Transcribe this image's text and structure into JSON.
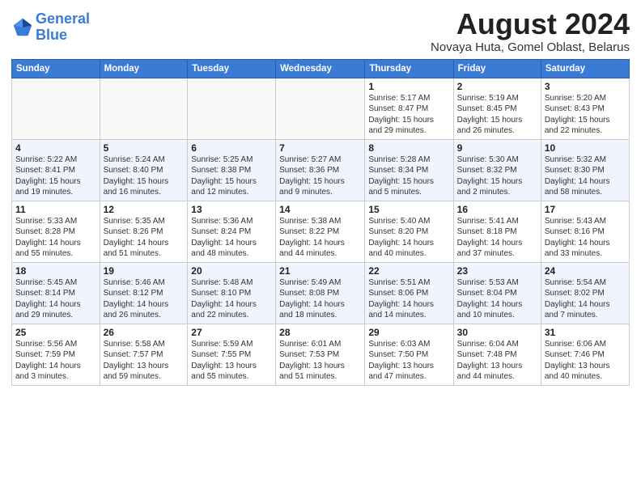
{
  "header": {
    "logo_line1": "General",
    "logo_line2": "Blue",
    "title": "August 2024",
    "subtitle": "Novaya Huta, Gomel Oblast, Belarus"
  },
  "days_of_week": [
    "Sunday",
    "Monday",
    "Tuesday",
    "Wednesday",
    "Thursday",
    "Friday",
    "Saturday"
  ],
  "weeks": [
    [
      {
        "day": "",
        "info": ""
      },
      {
        "day": "",
        "info": ""
      },
      {
        "day": "",
        "info": ""
      },
      {
        "day": "",
        "info": ""
      },
      {
        "day": "1",
        "info": "Sunrise: 5:17 AM\nSunset: 8:47 PM\nDaylight: 15 hours\nand 29 minutes."
      },
      {
        "day": "2",
        "info": "Sunrise: 5:19 AM\nSunset: 8:45 PM\nDaylight: 15 hours\nand 26 minutes."
      },
      {
        "day": "3",
        "info": "Sunrise: 5:20 AM\nSunset: 8:43 PM\nDaylight: 15 hours\nand 22 minutes."
      }
    ],
    [
      {
        "day": "4",
        "info": "Sunrise: 5:22 AM\nSunset: 8:41 PM\nDaylight: 15 hours\nand 19 minutes."
      },
      {
        "day": "5",
        "info": "Sunrise: 5:24 AM\nSunset: 8:40 PM\nDaylight: 15 hours\nand 16 minutes."
      },
      {
        "day": "6",
        "info": "Sunrise: 5:25 AM\nSunset: 8:38 PM\nDaylight: 15 hours\nand 12 minutes."
      },
      {
        "day": "7",
        "info": "Sunrise: 5:27 AM\nSunset: 8:36 PM\nDaylight: 15 hours\nand 9 minutes."
      },
      {
        "day": "8",
        "info": "Sunrise: 5:28 AM\nSunset: 8:34 PM\nDaylight: 15 hours\nand 5 minutes."
      },
      {
        "day": "9",
        "info": "Sunrise: 5:30 AM\nSunset: 8:32 PM\nDaylight: 15 hours\nand 2 minutes."
      },
      {
        "day": "10",
        "info": "Sunrise: 5:32 AM\nSunset: 8:30 PM\nDaylight: 14 hours\nand 58 minutes."
      }
    ],
    [
      {
        "day": "11",
        "info": "Sunrise: 5:33 AM\nSunset: 8:28 PM\nDaylight: 14 hours\nand 55 minutes."
      },
      {
        "day": "12",
        "info": "Sunrise: 5:35 AM\nSunset: 8:26 PM\nDaylight: 14 hours\nand 51 minutes."
      },
      {
        "day": "13",
        "info": "Sunrise: 5:36 AM\nSunset: 8:24 PM\nDaylight: 14 hours\nand 48 minutes."
      },
      {
        "day": "14",
        "info": "Sunrise: 5:38 AM\nSunset: 8:22 PM\nDaylight: 14 hours\nand 44 minutes."
      },
      {
        "day": "15",
        "info": "Sunrise: 5:40 AM\nSunset: 8:20 PM\nDaylight: 14 hours\nand 40 minutes."
      },
      {
        "day": "16",
        "info": "Sunrise: 5:41 AM\nSunset: 8:18 PM\nDaylight: 14 hours\nand 37 minutes."
      },
      {
        "day": "17",
        "info": "Sunrise: 5:43 AM\nSunset: 8:16 PM\nDaylight: 14 hours\nand 33 minutes."
      }
    ],
    [
      {
        "day": "18",
        "info": "Sunrise: 5:45 AM\nSunset: 8:14 PM\nDaylight: 14 hours\nand 29 minutes."
      },
      {
        "day": "19",
        "info": "Sunrise: 5:46 AM\nSunset: 8:12 PM\nDaylight: 14 hours\nand 26 minutes."
      },
      {
        "day": "20",
        "info": "Sunrise: 5:48 AM\nSunset: 8:10 PM\nDaylight: 14 hours\nand 22 minutes."
      },
      {
        "day": "21",
        "info": "Sunrise: 5:49 AM\nSunset: 8:08 PM\nDaylight: 14 hours\nand 18 minutes."
      },
      {
        "day": "22",
        "info": "Sunrise: 5:51 AM\nSunset: 8:06 PM\nDaylight: 14 hours\nand 14 minutes."
      },
      {
        "day": "23",
        "info": "Sunrise: 5:53 AM\nSunset: 8:04 PM\nDaylight: 14 hours\nand 10 minutes."
      },
      {
        "day": "24",
        "info": "Sunrise: 5:54 AM\nSunset: 8:02 PM\nDaylight: 14 hours\nand 7 minutes."
      }
    ],
    [
      {
        "day": "25",
        "info": "Sunrise: 5:56 AM\nSunset: 7:59 PM\nDaylight: 14 hours\nand 3 minutes."
      },
      {
        "day": "26",
        "info": "Sunrise: 5:58 AM\nSunset: 7:57 PM\nDaylight: 13 hours\nand 59 minutes."
      },
      {
        "day": "27",
        "info": "Sunrise: 5:59 AM\nSunset: 7:55 PM\nDaylight: 13 hours\nand 55 minutes."
      },
      {
        "day": "28",
        "info": "Sunrise: 6:01 AM\nSunset: 7:53 PM\nDaylight: 13 hours\nand 51 minutes."
      },
      {
        "day": "29",
        "info": "Sunrise: 6:03 AM\nSunset: 7:50 PM\nDaylight: 13 hours\nand 47 minutes."
      },
      {
        "day": "30",
        "info": "Sunrise: 6:04 AM\nSunset: 7:48 PM\nDaylight: 13 hours\nand 44 minutes."
      },
      {
        "day": "31",
        "info": "Sunrise: 6:06 AM\nSunset: 7:46 PM\nDaylight: 13 hours\nand 40 minutes."
      }
    ]
  ]
}
